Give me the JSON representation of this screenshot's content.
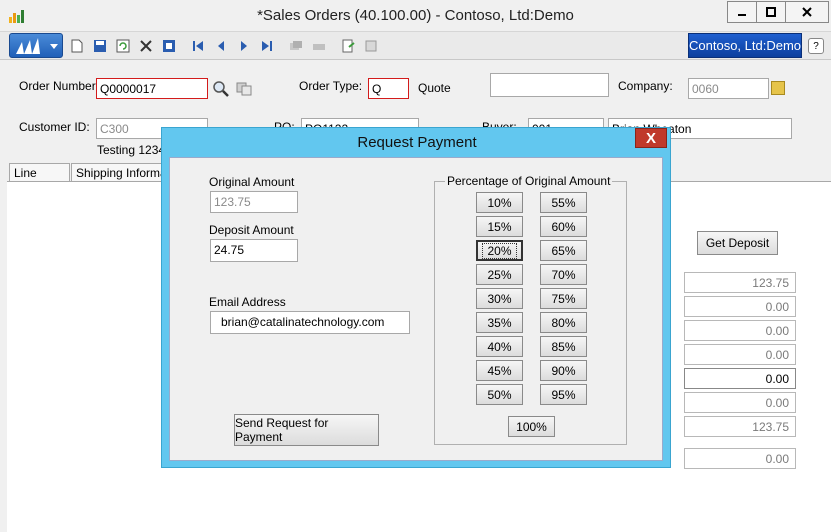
{
  "window": {
    "title": "*Sales Orders (40.100.00) - Contoso, Ltd:Demo"
  },
  "toolbar": {
    "company_button": "Contoso, Ltd:Demo",
    "help": "?"
  },
  "form": {
    "order_number_label": "Order Number:",
    "order_number_value": "Q0000017",
    "order_type_label": "Order Type:",
    "order_type_value": "Q",
    "order_type_desc": "Quote",
    "company_label": "Company:",
    "company_value": "0060",
    "customer_id_label": "Customer ID:",
    "customer_id_value": "C300",
    "customer_name": "Testing 1234",
    "po_label": "PO:",
    "po_value": "PO1122",
    "buyer_label": "Buyer:",
    "buyer_code": "001",
    "buyer_name": "Brian Wheaton"
  },
  "tabs": [
    "Line Items",
    "Shipping Informat"
  ],
  "main": {
    "get_deposit_button": "Get Deposit",
    "amounts": [
      "123.75",
      "0.00",
      "0.00",
      "0.00",
      "0.00",
      "0.00",
      "123.75",
      "0.00"
    ]
  },
  "dialog": {
    "title": "Request Payment",
    "close": "X",
    "original_amount_label": "Original Amount",
    "original_amount_value": "123.75",
    "deposit_amount_label": "Deposit Amount",
    "deposit_amount_value": "24.75",
    "email_label": "Email Address",
    "email_value": "brian@catalinatechnology.com",
    "send_button": "Send Request for Payment",
    "percentage_group_label": "Percentage of Original Amount",
    "percent_left": [
      "10%",
      "15%",
      "20%",
      "25%",
      "30%",
      "35%",
      "40%",
      "45%",
      "50%"
    ],
    "percent_right": [
      "55%",
      "60%",
      "65%",
      "70%",
      "75%",
      "80%",
      "85%",
      "90%",
      "95%"
    ],
    "percent_full": "100%",
    "selected_percent": "20%"
  }
}
